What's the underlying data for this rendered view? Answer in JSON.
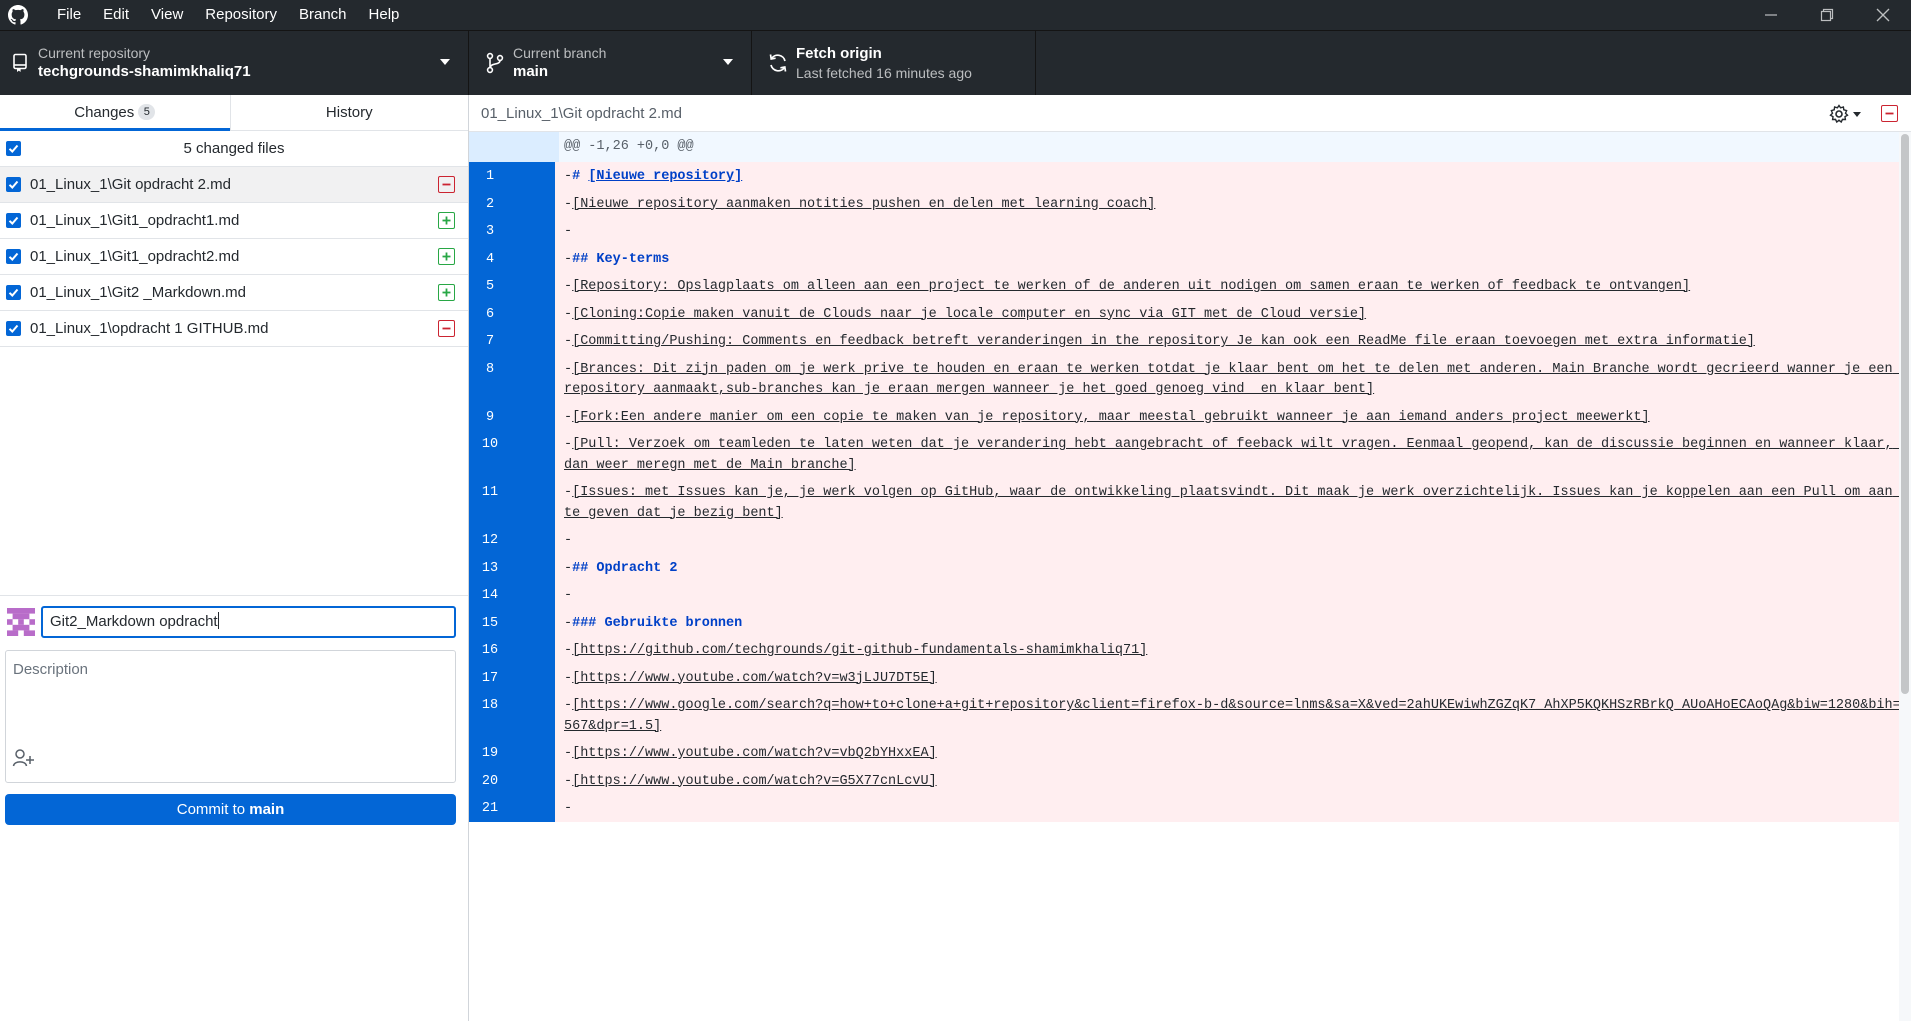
{
  "menu": [
    "File",
    "Edit",
    "View",
    "Repository",
    "Branch",
    "Help"
  ],
  "toolbar": {
    "repo_label": "Current repository",
    "repo_value": "techgrounds-shamimkhaliq71",
    "branch_label": "Current branch",
    "branch_value": "main",
    "fetch_title": "Fetch origin",
    "fetch_sub": "Last fetched 16 minutes ago"
  },
  "tabs": {
    "changes": "Changes",
    "changes_count": "5",
    "history": "History"
  },
  "changes": {
    "header": "5 changed files",
    "files": [
      {
        "name": "01_Linux_1\\Git opdracht 2.md",
        "status": "deleted"
      },
      {
        "name": "01_Linux_1\\Git1_opdracht1.md",
        "status": "added"
      },
      {
        "name": "01_Linux_1\\Git1_opdracht2.md",
        "status": "added"
      },
      {
        "name": "01_Linux_1\\Git2 _Markdown.md",
        "status": "added"
      },
      {
        "name": "01_Linux_1\\opdracht 1 GITHUB.md",
        "status": "deleted"
      }
    ]
  },
  "commit": {
    "summary_value": "Git2_Markdown opdracht",
    "description_placeholder": "Description",
    "button_prefix": "Commit to ",
    "button_branch": "main"
  },
  "diff": {
    "path": "01_Linux_1\\Git opdracht 2.md",
    "hunk": "@@ -1,26 +0,0 @@",
    "lines": [
      {
        "n": "1",
        "prefix": "-",
        "text": "# [Nieuwe repository]",
        "style": "heading"
      },
      {
        "n": "2",
        "prefix": "-",
        "text": "[Nieuwe repository aanmaken notities pushen en delen met learning coach]",
        "style": "link"
      },
      {
        "n": "3",
        "prefix": "-",
        "text": "",
        "style": "plain"
      },
      {
        "n": "4",
        "prefix": "-",
        "text": "## Key-terms",
        "style": "heading"
      },
      {
        "n": "5",
        "prefix": "-",
        "text": "[Repository: Opslagplaats om alleen aan een project te werken of de anderen uit nodigen om samen eraan te werken of feedback te ontvangen]",
        "style": "link"
      },
      {
        "n": "6",
        "prefix": "-",
        "text": "[Cloning:Copie maken vanuit de Clouds naar je locale computer en sync via GIT met de Cloud versie]",
        "style": "link"
      },
      {
        "n": "7",
        "prefix": "-",
        "text": "[Committing/Pushing: Comments en feedback betreft veranderingen in the repository Je kan ook een ReadMe file eraan toevoegen met extra informatie]",
        "style": "link"
      },
      {
        "n": "8",
        "prefix": "-",
        "text": "[Brances: Dit zijn paden om je werk prive te houden en eraan te werken totdat je klaar bent om het te delen met anderen. Main Branche wordt gecrieerd wanner je een repository aanmaakt,sub-branches kan je eraan mergen wanneer je het goed genoeg vind  en klaar bent]",
        "style": "link"
      },
      {
        "n": "9",
        "prefix": "-",
        "text": "[Fork:Een andere manier om een copie te maken van je repository, maar meestal gebruikt wanneer je aan iemand anders project meewerkt]",
        "style": "link"
      },
      {
        "n": "10",
        "prefix": "-",
        "text": "[Pull: Verzoek om teamleden te laten weten dat je verandering hebt aangebracht of feeback wilt vragen. Eenmaal geopend, kan de discussie beginnen en wanneer klaar, dan weer meregn met de Main branche]",
        "style": "link"
      },
      {
        "n": "11",
        "prefix": "-",
        "text": "[Issues: met Issues kan je, je werk volgen op GitHub, waar de ontwikkeling plaatsvindt. Dit maak je werk overzichtelijk. Issues kan je koppelen aan een Pull om aan te geven dat je bezig bent]",
        "style": "link"
      },
      {
        "n": "12",
        "prefix": "-",
        "text": "",
        "style": "plain"
      },
      {
        "n": "13",
        "prefix": "-",
        "text": "## Opdracht 2",
        "style": "heading"
      },
      {
        "n": "14",
        "prefix": "-",
        "text": "",
        "style": "plain"
      },
      {
        "n": "15",
        "prefix": "-",
        "text": "### Gebruikte bronnen",
        "style": "heading"
      },
      {
        "n": "16",
        "prefix": "-",
        "text": "[https://github.com/techgrounds/git-github-fundamentals-shamimkhaliq71]",
        "style": "link"
      },
      {
        "n": "17",
        "prefix": "-",
        "text": "[https://www.youtube.com/watch?v=w3jLJU7DT5E]",
        "style": "link"
      },
      {
        "n": "18",
        "prefix": "-",
        "text": "[https://www.google.com/search?q=how+to+clone+a+git+repository&client=firefox-b-d&source=lnms&sa=X&ved=2ahUKEwiwhZGZqK7_AhXP5KQKHSzRBrkQ_AUoAHoECAoQAg&biw=1280&bih=567&dpr=1.5]",
        "style": "link"
      },
      {
        "n": "19",
        "prefix": "-",
        "text": "[https://www.youtube.com/watch?v=vbQ2bYHxxEA]",
        "style": "link"
      },
      {
        "n": "20",
        "prefix": "-",
        "text": "[https://www.youtube.com/watch?v=G5X77cnLcvU]",
        "style": "link"
      },
      {
        "n": "21",
        "prefix": "-",
        "text": "",
        "style": "plain"
      }
    ]
  },
  "colors": {
    "titlebar": "#24292e",
    "accent": "#0366d6",
    "deleted_bg": "#ffeef0",
    "deleted_icon": "#cb2431",
    "added_icon": "#28a745"
  }
}
